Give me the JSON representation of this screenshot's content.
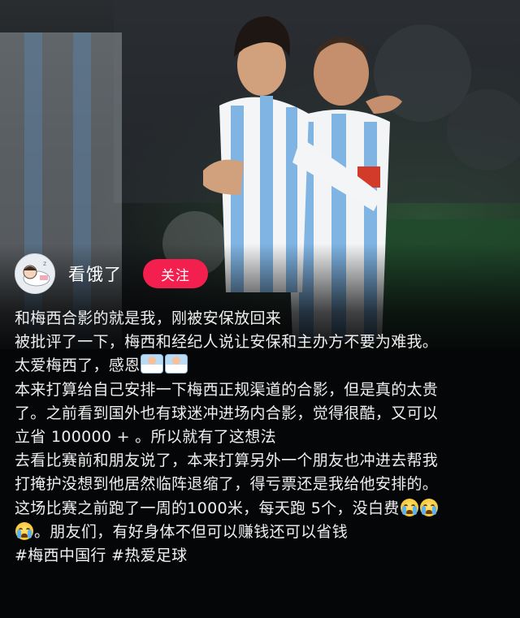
{
  "profile": {
    "username": "看饿了",
    "follow_label": "关注",
    "avatar_icon": "cartoon-avatar-icon"
  },
  "post": {
    "lines": [
      "和梅西合影的就是我，刚被安保放回来",
      "被批评了一下，梅西和经纪人说让安保和主办方不要为难我。",
      "太爱梅西了，感恩",
      "本来打算给自己安排一下梅西正规渠道的合影，但是真的太贵",
      "了。之前看到国外也有球迷冲进场内合影，觉得很酷，又可以",
      "立省 100000 + 。所以就有了这想法",
      "去看比赛前和朋友说了，本来打算另外一个朋友也冲进去帮我",
      "打掩护没想到他居然临阵退缩了，得亏票还是我给他安排的。",
      "这场比赛之前跑了一周的1000米，每天跑 5个，没白费",
      "。朋友们，有好身体不但可以赚钱还可以省钱"
    ],
    "hashtags": "#梅西中国行  #热爱足球"
  },
  "colors": {
    "follow_button": "#f21f4f",
    "jersey_blue": "#7fb4e3"
  }
}
